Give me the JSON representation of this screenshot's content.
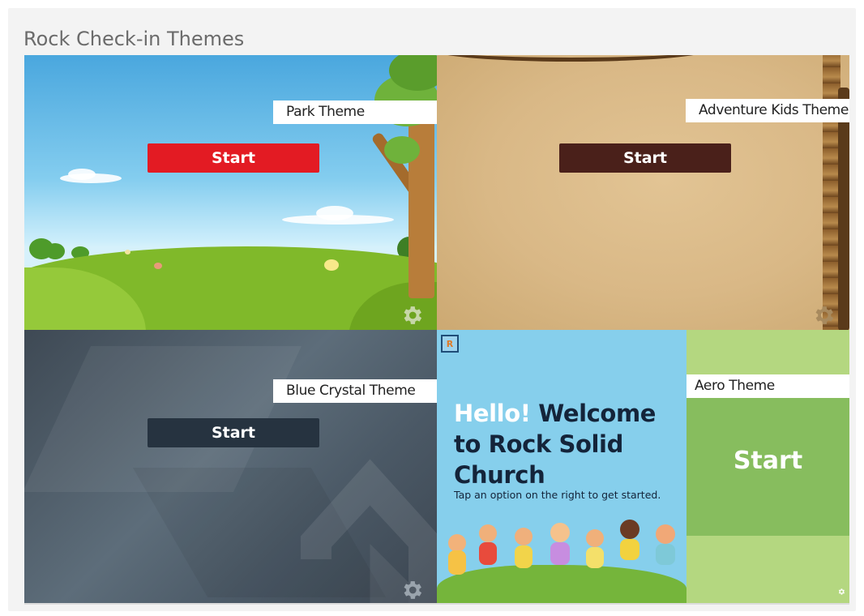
{
  "page": {
    "title": "Rock Check-in Themes"
  },
  "themes": [
    {
      "label": "Park Theme",
      "start_label": "Start",
      "button_color": "#e31b23"
    },
    {
      "label": "Adventure Kids Theme",
      "start_label": "Start",
      "button_color": "#4a201a"
    },
    {
      "label": "Blue Crystal Theme",
      "start_label": "Start",
      "button_color": "#263340"
    },
    {
      "label": "Aero Theme",
      "start_label": "Start",
      "button_color": "#87bd5e"
    }
  ],
  "aero": {
    "hello": "Hello!",
    "welcome": "Welcome to Rock Solid Church",
    "subtitle": "Tap an option on the right to get started.",
    "logo_text": "R"
  },
  "icons": {
    "settings": "gear-icon",
    "logo": "rock-logo-icon"
  }
}
